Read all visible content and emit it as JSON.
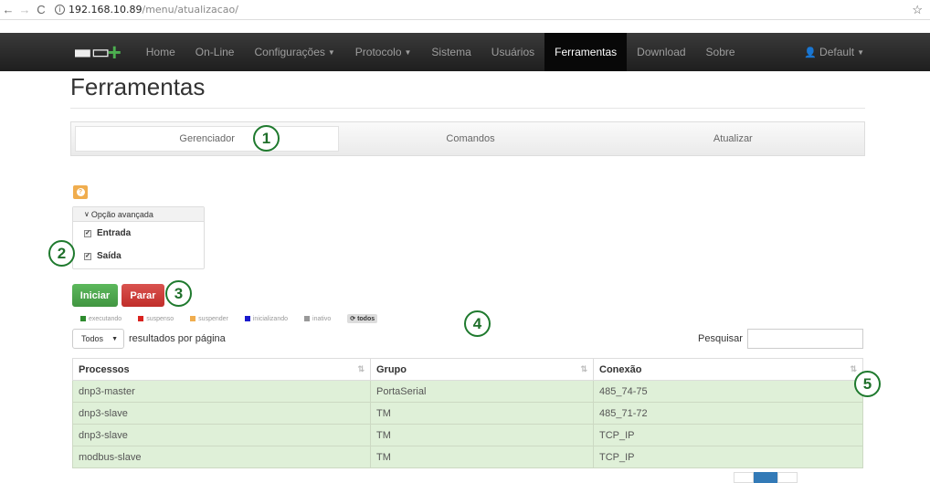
{
  "browser": {
    "url_host": "192.168.10.89",
    "url_path": "/menu/atualizacao/"
  },
  "navbar": {
    "items": [
      {
        "label": "Home"
      },
      {
        "label": "On-Line"
      },
      {
        "label": "Configurações"
      },
      {
        "label": "Protocolo"
      },
      {
        "label": "Sistema"
      },
      {
        "label": "Usuários"
      },
      {
        "label": "Ferramentas"
      },
      {
        "label": "Download"
      },
      {
        "label": "Sobre"
      }
    ],
    "active": "Ferramentas",
    "user": "Default"
  },
  "page": {
    "title": "Ferramentas"
  },
  "tabs": [
    {
      "label": "Gerenciador"
    },
    {
      "label": "Comandos"
    },
    {
      "label": "Atualizar"
    }
  ],
  "advanced": {
    "header": "Opção avançada",
    "options": [
      {
        "label": "Entrada",
        "checked": true
      },
      {
        "label": "Saída",
        "checked": true
      }
    ]
  },
  "actions": {
    "start": "Iniciar",
    "stop": "Parar"
  },
  "legend": [
    {
      "label": "executando",
      "color": "#2e8b2e"
    },
    {
      "label": "suspenso",
      "color": "#d9231f"
    },
    {
      "label": "suspender",
      "color": "#f0ad4e"
    },
    {
      "label": "inicializando",
      "color": "#1a1acc"
    },
    {
      "label": "inativo",
      "color": "#999999"
    }
  ],
  "legend_all": "todos",
  "table_controls": {
    "page_size": "Todos",
    "page_size_suffix": "resultados por página",
    "search_label": "Pesquisar"
  },
  "table": {
    "headers": [
      "Processos",
      "Grupo",
      "Conexão"
    ],
    "rows": [
      [
        "dnp3-master",
        "PortaSerial",
        "485_74-75"
      ],
      [
        "dnp3-slave",
        "TM",
        "485_71-72"
      ],
      [
        "dnp3-slave",
        "TM",
        "TCP_IP"
      ],
      [
        "modbus-slave",
        "TM",
        "TCP_IP"
      ]
    ]
  },
  "callouts": [
    "1",
    "2",
    "3",
    "4",
    "5"
  ]
}
